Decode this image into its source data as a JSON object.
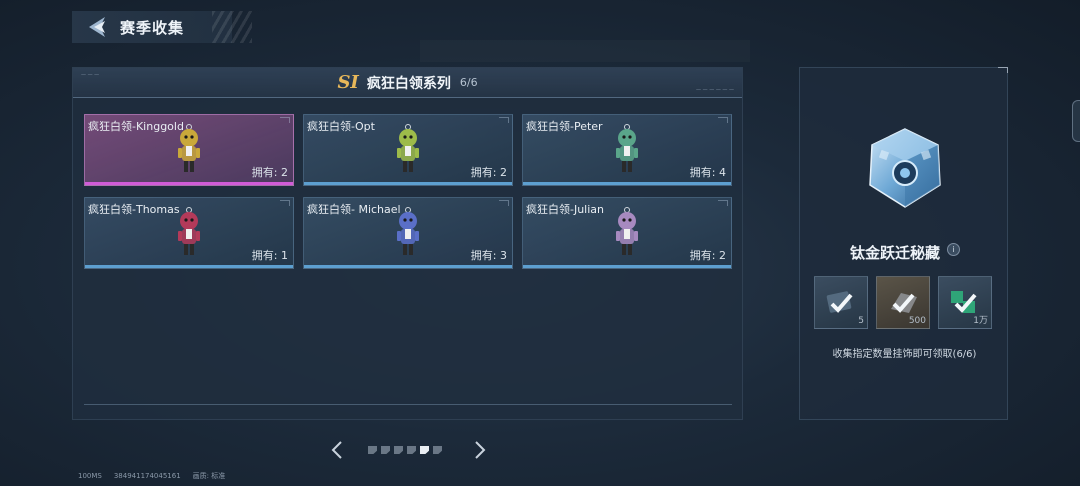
{
  "header": {
    "title": "赛季收集"
  },
  "series": {
    "badge": "SI",
    "name": "疯狂白领系列",
    "progress": "6/6",
    "corner_text_left": "— — —",
    "corner_text_right": "— — — — — —"
  },
  "cards": [
    {
      "name": "疯狂白领-Kinggold",
      "owned": "拥有: 2",
      "selected": true,
      "color": "#c9a83a"
    },
    {
      "name": "疯狂白领-Opt",
      "owned": "拥有: 2",
      "selected": false,
      "color": "#9dbb4a"
    },
    {
      "name": "疯狂白领-Peter",
      "owned": "拥有: 4",
      "selected": false,
      "color": "#5aa58a"
    },
    {
      "name": "疯狂白领-Thomas",
      "owned": "拥有: 1",
      "selected": false,
      "color": "#b33a5a"
    },
    {
      "name": "疯狂白领- Michael",
      "owned": "拥有: 3",
      "selected": false,
      "color": "#5a6fc7"
    },
    {
      "name": "疯狂白领-Julian",
      "owned": "拥有: 2",
      "selected": false,
      "color": "#a78ac0"
    }
  ],
  "pagination": {
    "pages": 6,
    "active": 5
  },
  "status_bar": {
    "ping": "100MS",
    "id": "384941174045161",
    "quality": "画质: 标准"
  },
  "reward": {
    "title": "钛金跃迁秘藏",
    "info": "i",
    "items": [
      {
        "qty": "5",
        "icon": "check-icon",
        "style": "blue"
      },
      {
        "qty": "500",
        "icon": "check-icon",
        "style": "brown"
      },
      {
        "qty": "1万",
        "icon": "check-icon",
        "style": "blue"
      }
    ],
    "description": "收集指定数量挂饰即可领取(6/6)"
  }
}
